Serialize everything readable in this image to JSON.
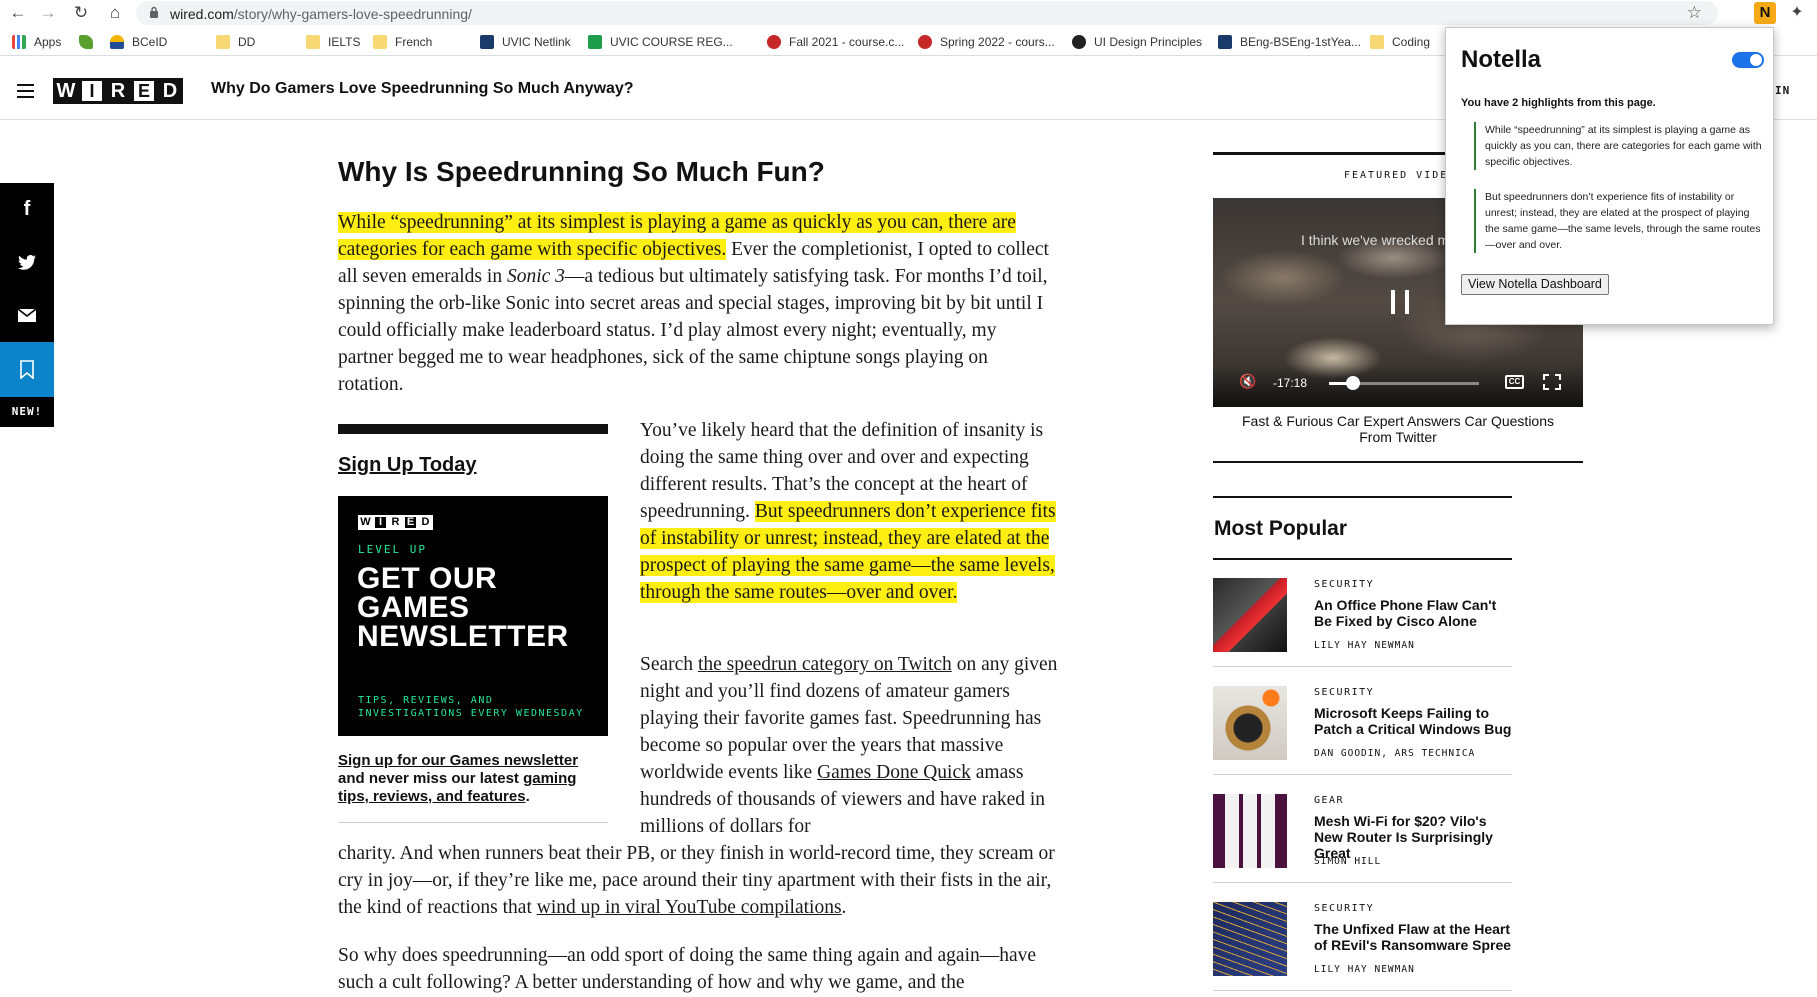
{
  "browser": {
    "url_domain": "wired.com",
    "url_path": "/story/why-gamers-love-speedrunning/",
    "extension_letter": "N",
    "bookmarks": [
      "Apps",
      "BCeID",
      "DD",
      "IELTS",
      "French",
      "UVIC Netlink",
      "UVIC COURSE REG...",
      "Fall 2021 - course.c...",
      "Spring 2022 - cours...",
      "UI Design Principles",
      "BEng-BSEng-1stYea...",
      "Coding"
    ]
  },
  "header": {
    "logo_letters": [
      "W",
      "I",
      "R",
      "E",
      "D"
    ],
    "title": "Why Do Gamers Love Speedrunning So Much Anyway?",
    "signin_fragment": "IN"
  },
  "share": {
    "facebook": "f",
    "new_label": "NEW!"
  },
  "article": {
    "heading": "Why Is Speedrunning So Much Fun?",
    "p1": {
      "highlight": "While “speedrunning” at its simplest is playing a game as quickly as you can, there are categories for each game with specific objectives.",
      "a": " Ever the completionist, I opted to collect all seven emeralds in ",
      "em": "Sonic 3",
      "b": "—a tedious but ultimately satisfying task. For months I’d toil, spinning the orb-like Sonic into secret areas and special stages, improving bit by bit until I could officially make leaderboard status. I’d play almost every night; eventually, my partner begged me to wear headphones, sick of the same chiptune songs playing on rotation."
    },
    "p2": {
      "a": "You’ve likely heard that the definition of insanity is doing the same thing over and over and expecting different results. That’s the concept at the heart of speedrunning. ",
      "highlight": "But speedrunners don’t experience fits of instability or unrest; instead, they are elated at the prospect of playing the same game—the same levels, through the same routes—over and over."
    },
    "p3": {
      "a": "Search ",
      "link1": "the speedrun category on Twitch",
      "b": " on any given night and you’ll find dozens of amateur gamers playing their favorite games fast. Speedrunning has become so popular over the years that massive worldwide events like ",
      "link2": "Games Done Quick",
      "c": " amass hundreds of thousands of viewers and have raked in millions of dollars for"
    },
    "p4": {
      "a": "charity. And when runners beat their PB, or they finish in world-record time, they scream or cry in joy—or, if they’re like me, pace around their tiny apartment with their fists in the air, the kind of reactions that ",
      "link": "wind up in viral YouTube compilations",
      "b": "."
    },
    "p5": "So why does speedrunning—an odd sport of doing the same thing again and again—have such a cult following? A better understanding of how and why we game, and the"
  },
  "newsletter": {
    "signup": "Sign Up Today",
    "mini_logo": [
      "W",
      "I",
      "R",
      "E",
      "D"
    ],
    "level_up": "LEVEL UP",
    "big_lines": [
      "GET OUR",
      "GAMES",
      "NEWSLETTER"
    ],
    "tips_lines": [
      "TIPS, REVIEWS, AND",
      "INVESTIGATIONS EVERY WEDNESDAY"
    ],
    "caption_link": "Sign up for our Games newsletter",
    "caption_text": " and never miss our latest ",
    "caption_link2": "gaming tips, reviews, and features",
    "caption_end": "."
  },
  "featured": {
    "label": "FEATURED VIDEO",
    "caption_overlay": "I think we've wrecked m",
    "time": "-17:18",
    "progress": 0.16,
    "cc": "CC",
    "title": "Fast & Furious Car Expert Answers Car Questions From Twitter"
  },
  "most_popular": {
    "title": "Most Popular",
    "items": [
      {
        "category": "SECURITY",
        "title": "An Office Phone Flaw Can't Be Fixed by Cisco Alone",
        "author": "LILY HAY NEWMAN"
      },
      {
        "category": "SECURITY",
        "title": "Microsoft Keeps Failing to Patch a Critical Windows Bug",
        "author": "DAN GOODIN, ARS TECHNICA"
      },
      {
        "category": "GEAR",
        "title": "Mesh Wi-Fi for $20? Vilo's New Router Is Surprisingly Great",
        "author": "SIMON HILL"
      },
      {
        "category": "SECURITY",
        "title": "The Unfixed Flaw at the Heart of REvil's Ransomware Spree",
        "author": "LILY HAY NEWMAN"
      }
    ]
  },
  "notella": {
    "title": "Notella",
    "enabled": true,
    "summary": "You have 2 highlights from this page.",
    "highlights": [
      "While “speedrunning” at its simplest is playing a game as quickly as you can, there are categories for each game with specific objectives.",
      "But speedrunners don’t experience fits of instability or unrest; instead, they are elated at the prospect of playing the same game—the same levels, through the same routes—over and over."
    ],
    "dashboard_button": "View Notella Dashboard"
  },
  "colors": {
    "highlight": "#ffee12",
    "toggle": "#1a73e8",
    "accent_green": "#23e89e",
    "bookmark_share": "#0b84c9"
  }
}
